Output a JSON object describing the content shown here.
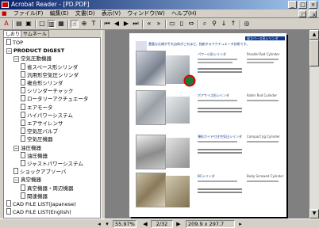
{
  "window": {
    "title": "Acrobat Reader - [PD.PDF]"
  },
  "menu": [
    "ファイル(F)",
    "編集(E)",
    "文書(D)",
    "表示(V)",
    "ウィンドウ(W)",
    "ヘルプ(H)"
  ],
  "tabs": [
    "しおり",
    "サムネール"
  ],
  "tree": [
    {
      "label": "TOP",
      "level": 0,
      "type": "doc"
    },
    {
      "label": "PRODUCT DIGEST",
      "level": 0,
      "type": "open",
      "bold": true
    },
    {
      "label": "空気圧動機器",
      "level": 1,
      "type": "open"
    },
    {
      "label": "省スペース形シリンダ",
      "level": 2,
      "type": "doc"
    },
    {
      "label": "汎用形空気圧シリンダ",
      "level": 2,
      "type": "doc"
    },
    {
      "label": "複合形シリンダ",
      "level": 2,
      "type": "doc"
    },
    {
      "label": "シリンダーチャック",
      "level": 2,
      "type": "doc"
    },
    {
      "label": "ロータリーアクチュエータ",
      "level": 2,
      "type": "doc"
    },
    {
      "label": "エアモータ",
      "level": 2,
      "type": "doc"
    },
    {
      "label": "ハイパワーシステム",
      "level": 2,
      "type": "doc"
    },
    {
      "label": "エアサイレンサ",
      "level": 2,
      "type": "doc"
    },
    {
      "label": "空気圧バルブ",
      "level": 2,
      "type": "doc"
    },
    {
      "label": "空気圧機器",
      "level": 2,
      "type": "doc"
    },
    {
      "label": "油圧機器",
      "level": 1,
      "type": "open"
    },
    {
      "label": "油圧機器",
      "level": 2,
      "type": "doc"
    },
    {
      "label": "ジャストパワーシステム",
      "level": 2,
      "type": "doc"
    },
    {
      "label": "ショックアブソーバ",
      "level": 1,
      "type": "doc"
    },
    {
      "label": "真空機器",
      "level": 1,
      "type": "open"
    },
    {
      "label": "真空機器・周辺機器",
      "level": 2,
      "type": "doc"
    },
    {
      "label": "関連機器",
      "level": 2,
      "type": "doc"
    },
    {
      "label": "CAD FILE LIST(Japanese)",
      "level": 0,
      "type": "doc"
    },
    {
      "label": "CAD FILE LIST(English)",
      "level": 0,
      "type": "doc"
    }
  ],
  "page_content": {
    "header_tag": "省スペース形シリンダ",
    "intro": "豊富な仕様がそれ自体がこれほど、独創するアクチュエータ技術です。",
    "items": [
      {
        "jp": "パワー小形シリンダ",
        "en": "Parallel Rod Cylinder"
      },
      {
        "jp": "ボアサイズ形シリンダ",
        "en": "Roller Rod Cylinder"
      },
      {
        "jp": "薄形ガイド付き空気圧シリンダ",
        "en": "Compact Jig Cylinder"
      },
      {
        "jp": "BCシリンダ",
        "en": "Body Screwed Cylinder"
      }
    ]
  },
  "status": {
    "zoom": "55.97%",
    "page": "2/32",
    "size": "209.9 x 297.7 mm"
  },
  "colors": {
    "titlebar_start": "#0a246a",
    "titlebar_end": "#a6caf0",
    "accent_circle": "#e00000"
  }
}
